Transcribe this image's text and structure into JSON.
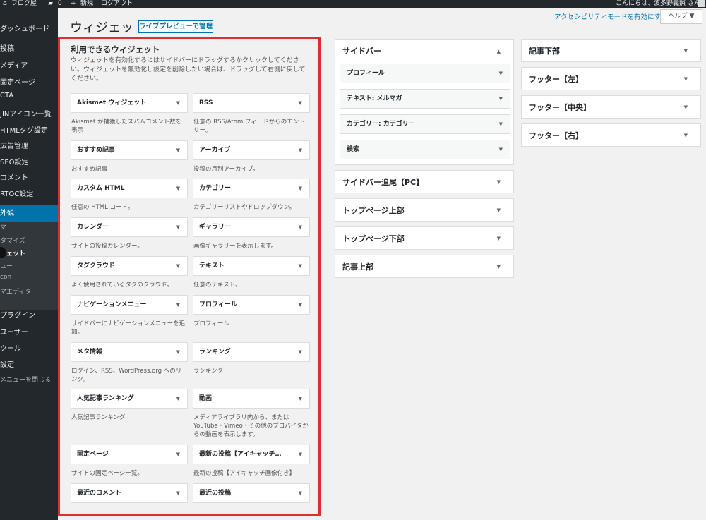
{
  "adminbar": {
    "home_label": "フロク屋",
    "comments_label": "0",
    "new_label": "新規",
    "logout_label": "ログアウト",
    "greeting": "こんにちは、波多野義照 さん"
  },
  "sidebar": {
    "items": [
      {
        "label": "ダッシュボード"
      },
      {
        "label": "投稿"
      },
      {
        "label": "メディア"
      },
      {
        "label": "固定ページ"
      },
      {
        "label": "CTA"
      },
      {
        "label": "JINアイコン一覧"
      },
      {
        "label": "HTMLタグ設定"
      },
      {
        "label": "広告管理"
      },
      {
        "label": "SEO設定"
      },
      {
        "label": "コメント"
      },
      {
        "label": "RTOC設定"
      },
      {
        "label": "外観"
      },
      {
        "label": "プラグイン"
      },
      {
        "label": "ユーザー"
      },
      {
        "label": "ツール"
      },
      {
        "label": "設定"
      },
      {
        "label": "メニューを閉じる"
      }
    ],
    "submenu": [
      {
        "label": "マ"
      },
      {
        "label": "タマイズ"
      },
      {
        "label": "ジェット"
      },
      {
        "label": "ュー"
      },
      {
        "label": "con"
      },
      {
        "label": "マエディター"
      }
    ]
  },
  "header": {
    "title": "ウィジェット",
    "live_preview_button": "ライブプレビューで管理",
    "accessibility_link": "アクセシビリティモードを有効にする",
    "help_button": "ヘルプ ▼"
  },
  "available": {
    "title": "利用できるウィジェット",
    "description": "ウィジェットを有効化するにはサイドバーにドラッグするかクリックしてください。ウィジェットを無効化し設定を削除したい場合は、ドラッグして右側に戻してください。",
    "widgets": [
      {
        "name": "Akismet ウィジェット",
        "desc": "Akismet が捕獲したスパムコメント数を表示"
      },
      {
        "name": "RSS",
        "desc": "任意の RSS/Atom フィードからのエントリー。"
      },
      {
        "name": "おすすめ記事",
        "desc": "おすすめ記事"
      },
      {
        "name": "アーカイブ",
        "desc": "投稿の月別アーカイブ。"
      },
      {
        "name": "カスタム HTML",
        "desc": "任意の HTML コード。"
      },
      {
        "name": "カテゴリー",
        "desc": "カテゴリーリストやドロップダウン。"
      },
      {
        "name": "カレンダー",
        "desc": "サイトの投稿カレンダー。"
      },
      {
        "name": "ギャラリー",
        "desc": "画像ギャラリーを表示します。"
      },
      {
        "name": "タグクラウド",
        "desc": "よく使用されているタグのクラウド。"
      },
      {
        "name": "テキスト",
        "desc": "任意のテキスト。"
      },
      {
        "name": "ナビゲーションメニュー",
        "desc": "サイドバーにナビゲーションメニューを追加。"
      },
      {
        "name": "プロフィール",
        "desc": "プロフィール"
      },
      {
        "name": "メタ情報",
        "desc": "ログイン、RSS、WordPress.org へのリンク。"
      },
      {
        "name": "ランキング",
        "desc": "ランキング"
      },
      {
        "name": "人気記事ランキング",
        "desc": "人気記事ランキング"
      },
      {
        "name": "動画",
        "desc": "メディアライブラリ内から、または YouTube・Vimeo・その他のプロバイダからの動画を表示します。"
      },
      {
        "name": "固定ページ",
        "desc": "サイトの固定ページ一覧。"
      },
      {
        "name": "最新の投稿【アイキャッチ…",
        "desc": "最新の投稿【アイキャッチ画像付き】"
      },
      {
        "name": "最近のコメント",
        "desc": ""
      },
      {
        "name": "最近の投稿",
        "desc": ""
      }
    ]
  },
  "areas_col1": [
    {
      "title": "サイドバー",
      "caret": "▲",
      "widgets": [
        {
          "name": "プロフィール"
        },
        {
          "name": "テキスト: メルマガ"
        },
        {
          "name": "カテゴリー: カテゴリー"
        },
        {
          "name": "検索"
        }
      ]
    },
    {
      "title": "サイドバー追尾【PC】",
      "caret": "▼"
    },
    {
      "title": "トップページ上部",
      "caret": "▼"
    },
    {
      "title": "トップページ下部",
      "caret": "▼"
    },
    {
      "title": "記事上部",
      "caret": "▼"
    }
  ],
  "areas_col2": [
    {
      "title": "記事下部",
      "caret": "▼"
    },
    {
      "title": "フッター【左】",
      "caret": "▼"
    },
    {
      "title": "フッター【中央】",
      "caret": "▼"
    },
    {
      "title": "フッター【右】",
      "caret": "▼"
    }
  ],
  "caret_down": "▼",
  "colors": {
    "admin_bg": "#23282d",
    "accent": "#0073aa",
    "highlight_border": "#e02d2d"
  }
}
